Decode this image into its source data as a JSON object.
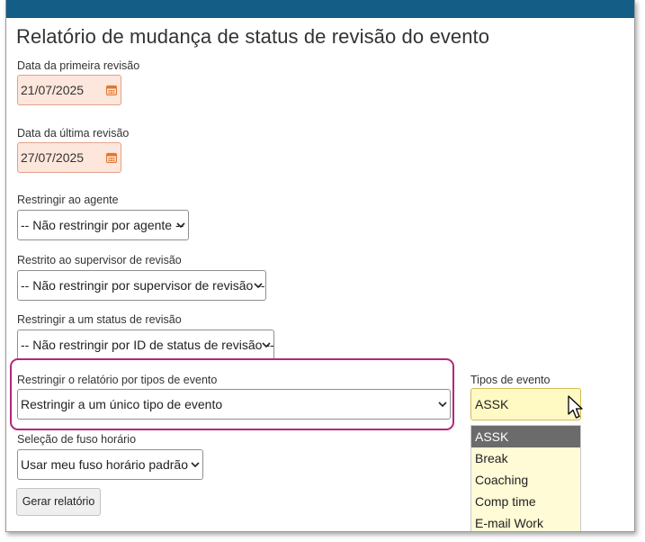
{
  "page": {
    "title": "Relatório de mudança de status de revisão do evento"
  },
  "first_review": {
    "label": "Data da primeira revisão",
    "value": "21/07/2025"
  },
  "last_review": {
    "label": "Data da última revisão",
    "value": "27/07/2025"
  },
  "agent": {
    "label": "Restringir ao agente",
    "selected": "-- Não restringir por agente --"
  },
  "supervisor": {
    "label": "Restrito ao supervisor de revisão",
    "selected": "-- Não restringir por supervisor de revisão --"
  },
  "review_status": {
    "label": "Restringir a um status de revisão",
    "selected": "-- Não restringir por ID de status de revisão --"
  },
  "event_types_restriction": {
    "label": "Restringir o relatório por tipos de evento",
    "selected": "Restringir a um único tipo de evento"
  },
  "event_types": {
    "label": "Tipos de evento",
    "selected": "ASSK",
    "options": [
      "ASSK",
      "Break",
      "Coaching",
      "Comp time",
      "E-mail Work"
    ]
  },
  "timezone": {
    "label": "Seleção de fuso horário",
    "selected": "Usar meu fuso horário padrão"
  },
  "actions": {
    "generate_label": "Gerar relatório"
  },
  "colors": {
    "topbar": "#145d86",
    "highlight": "#b2277c",
    "date_bg": "#fde6dc",
    "yellow_bg": "#fff9c4",
    "selected_option_bg": "#6b6b6b"
  }
}
